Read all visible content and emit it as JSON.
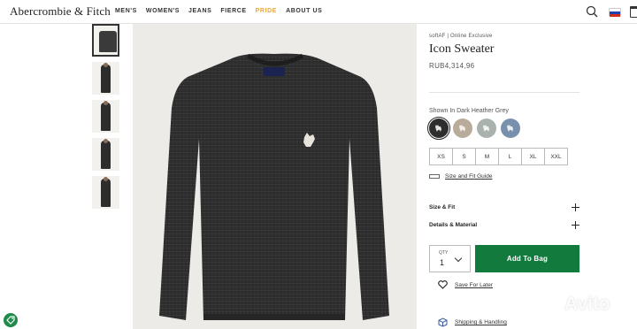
{
  "header": {
    "brand": "Abercrombie & Fitch",
    "nav": [
      "MEN'S",
      "WOMEN'S",
      "JEANS",
      "FIERCE",
      "PRIDE",
      "ABOUT US"
    ],
    "flag_colors": [
      "#ffffff",
      "#1d44b3",
      "#d52b1e"
    ]
  },
  "product": {
    "subtitle": "softAF | Online Exclusive",
    "name": "Icon Sweater",
    "price": "RUB4,314,96",
    "color_label": "Shown In Dark Heather Grey",
    "swatches": [
      {
        "color": "#2e2e2e",
        "selected": true
      },
      {
        "color": "#b9ab9a",
        "selected": false
      },
      {
        "color": "#a9b2ad",
        "selected": false
      },
      {
        "color": "#7990ad",
        "selected": false
      }
    ],
    "sizes": [
      "XS",
      "S",
      "M",
      "L",
      "XL",
      "XXL"
    ],
    "size_guide": "Size and Fit Guide",
    "size_fit_label": "Size & Fit",
    "details_label": "Details & Material",
    "qty_label": "QTY",
    "qty_value": "1",
    "add_to_bag": "Add To Bag",
    "save_for_later": "Save For Later",
    "shipping": "Shipping & Handling"
  },
  "watermark": "Avito",
  "colors": {
    "accent_green": "#117a3c",
    "pride": "#e8a73c",
    "sweater": "#2b2b2b"
  }
}
